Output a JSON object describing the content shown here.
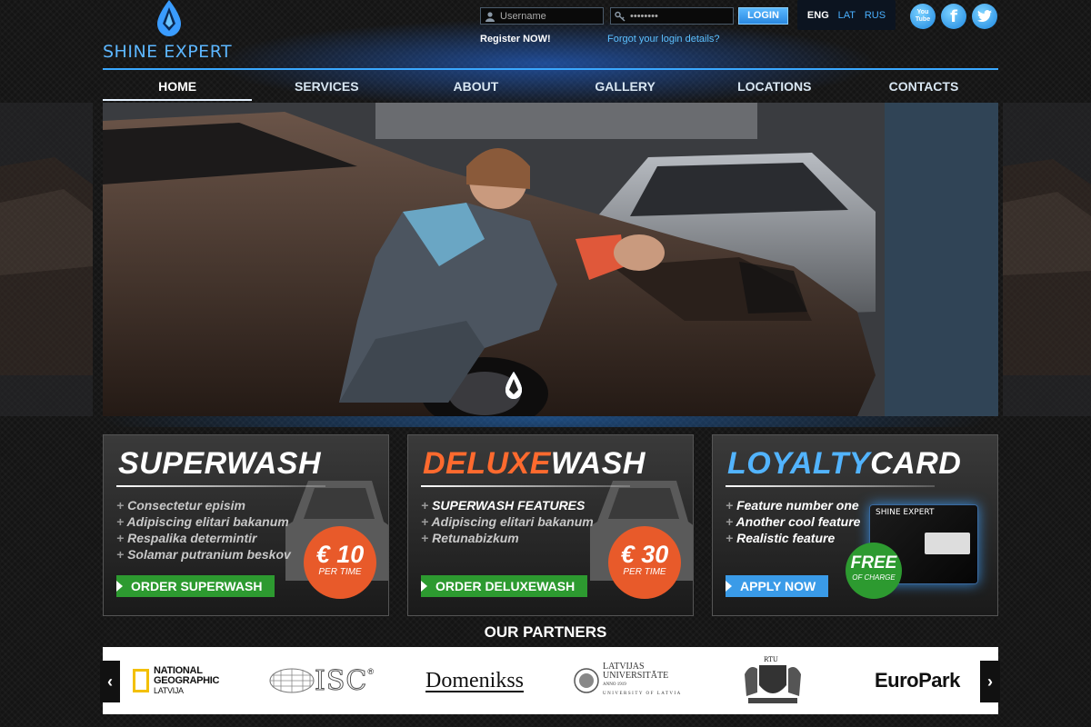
{
  "brand": {
    "name": "SHINE EXPERT"
  },
  "login": {
    "username_placeholder": "Username",
    "password_value": "••••••••",
    "login_label": "LOGIN",
    "register_label": "Register NOW!",
    "forgot_label": "Forgot your login details?"
  },
  "languages": [
    {
      "code": "ENG",
      "active": true
    },
    {
      "code": "LAT",
      "active": false
    },
    {
      "code": "RUS",
      "active": false
    }
  ],
  "social": {
    "youtube_line1": "You",
    "youtube_line2": "Tube",
    "facebook": "f",
    "twitter": "t"
  },
  "nav": [
    {
      "label": "HOME",
      "active": true
    },
    {
      "label": "SERVICES"
    },
    {
      "label": "ABOUT"
    },
    {
      "label": "GALLERY"
    },
    {
      "label": "LOCATIONS"
    },
    {
      "label": "CONTACTS"
    }
  ],
  "slider": {
    "slide_count": 4,
    "active_index": 1
  },
  "cards": [
    {
      "title_part1": "SUPERWASH",
      "title_part2": "",
      "features": [
        "Consectetur episim",
        "Adipiscing elitari bakanum",
        "Respalika determintir",
        "Solamar putranium beskov"
      ],
      "price": "€ 10",
      "price_unit": "PER TIME",
      "button": "ORDER SUPERWASH"
    },
    {
      "title_part1": "DELUXE",
      "title_part2": "WASH",
      "features": [
        "SUPERWASH FEATURES",
        "Adipiscing elitari bakanum",
        "Retunabizkum"
      ],
      "price": "€ 30",
      "price_unit": "PER TIME",
      "button": "ORDER DELUXEWASH"
    },
    {
      "title_part1": "LOYALTY",
      "title_part2": "CARD",
      "features": [
        "Feature number one",
        "Another cool feature",
        "Realistic feature"
      ],
      "badge": "FREE",
      "badge_unit": "OF CHARGE",
      "card_brand": "SHINE EXPERT",
      "button": "APPLY NOW"
    }
  ],
  "partners": {
    "title": "OUR PARTNERS",
    "natgeo_line1": "NATIONAL",
    "natgeo_line2": "GEOGRAPHIC",
    "natgeo_line3": "LATVIJA",
    "isc": "ISC",
    "isc_mark": "®",
    "domenikss": "Domenikss",
    "lu_line1": "LATVIJAS",
    "lu_line2": "UNIVERSITĀTE",
    "lu_line3": "ANNO 1919",
    "lu_line4": "UNIVERSITY OF LATVIA",
    "rtu": "RTU",
    "europark": "EuroPark"
  },
  "colors": {
    "accent": "#3aa8ff",
    "orange": "#e85a2a",
    "green": "#2d9a30",
    "blue_btn": "#3a9be8"
  }
}
